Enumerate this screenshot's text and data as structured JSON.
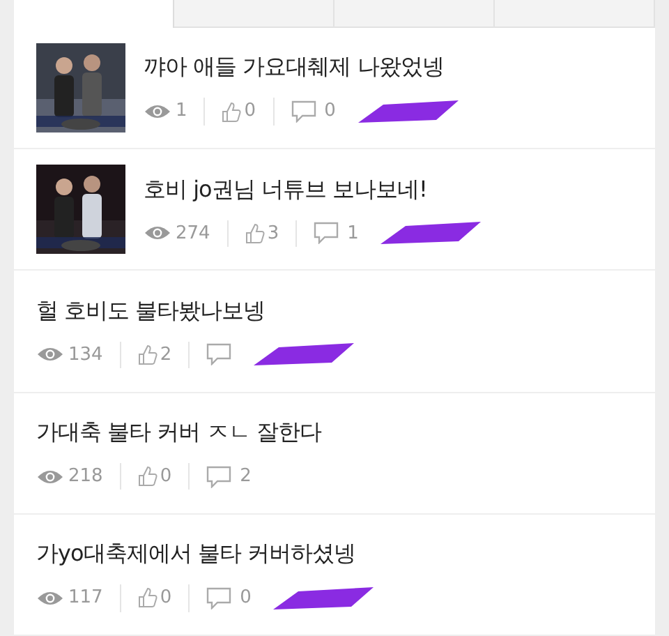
{
  "tabs": [
    {
      "selected": true
    },
    {
      "selected": false
    },
    {
      "selected": false
    },
    {
      "selected": false
    }
  ],
  "posts": [
    {
      "title": "꺄아 애들 가요대췌제 나왔었넹",
      "views": "1",
      "likes": "0",
      "comments": "0",
      "redacted": true
    },
    {
      "title": "호비 jo권님 너튜브 보나보네!",
      "views": "274",
      "likes": "3",
      "comments": "1",
      "redacted": true
    },
    {
      "title": "헐 호비도 불타봤나보넹",
      "views": "134",
      "likes": "2",
      "redacted": true
    },
    {
      "title": "가대축 불타 커버 ㅈㄴ 잘한다",
      "views": "218",
      "likes": "0",
      "comments": "2",
      "redacted": false
    },
    {
      "title": "가yo대축제에서 불타 커버하셨넹",
      "views": "117",
      "likes": "0",
      "comments": "0",
      "redacted": true
    }
  ]
}
